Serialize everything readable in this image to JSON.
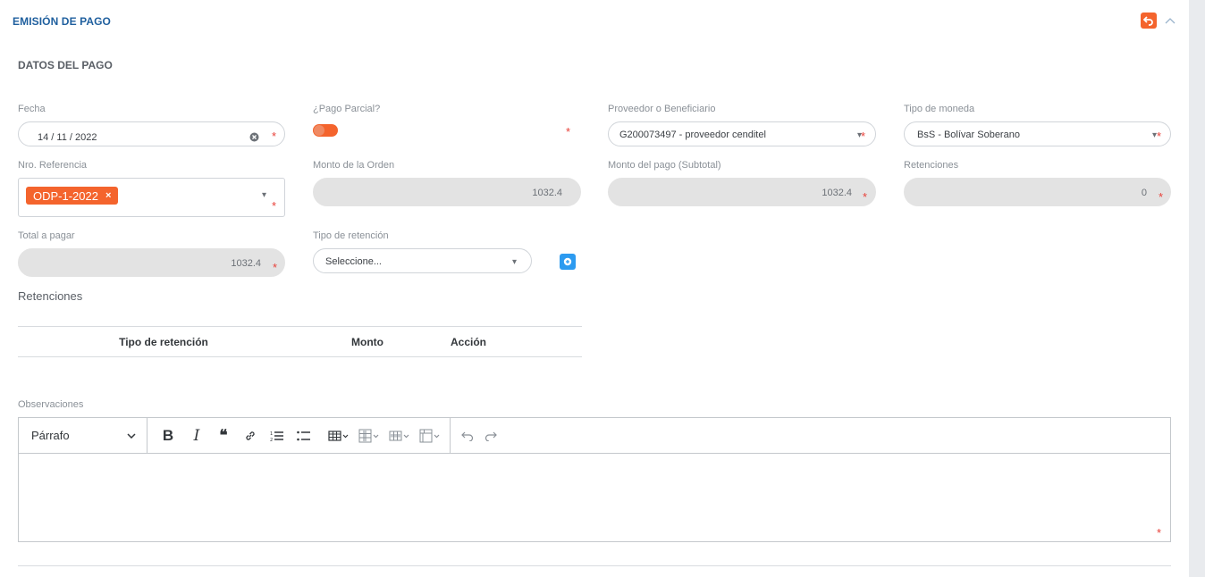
{
  "header": {
    "title": "EMISIÓN DE PAGO",
    "back_icon": "undo-icon",
    "collapse_icon": "chevron-up-icon"
  },
  "section": {
    "title": "DATOS DEL PAGO"
  },
  "fields": {
    "fecha": {
      "label": "Fecha",
      "value": "14 / 11 / 2022"
    },
    "pago_parcial": {
      "label": "¿Pago Parcial?"
    },
    "proveedor": {
      "label": "Proveedor o Beneficiario",
      "value": "G200073497 - proveedor cenditel"
    },
    "moneda": {
      "label": "Tipo de moneda",
      "value": "BsS - Bolívar Soberano"
    },
    "referencia": {
      "label": "Nro. Referencia",
      "tag": "ODP-1-2022",
      "tag_remove": "×"
    },
    "monto_orden": {
      "label": "Monto de la Orden",
      "value": "1032.4"
    },
    "monto_pago": {
      "label": "Monto del pago (Subtotal)",
      "value": "1032.4"
    },
    "retenciones": {
      "label": "Retenciones",
      "value": "0"
    },
    "total": {
      "label": "Total a pagar",
      "value": "1032.4"
    },
    "tipo_retencion": {
      "label": "Tipo de retención",
      "placeholder": "Seleccione..."
    }
  },
  "required_mark": "*",
  "retenciones_table": {
    "title": "Retenciones",
    "columns": [
      "Tipo de retención",
      "Monto",
      "Acción"
    ]
  },
  "observaciones": {
    "label": "Observaciones",
    "paragraph_select": "Párrafo",
    "toolbar_icons": [
      "bold-icon",
      "italic-icon",
      "blockquote-icon",
      "link-icon",
      "numbered-list-icon",
      "bulleted-list-icon",
      "insert-table-icon",
      "table-column-icon",
      "table-row-icon",
      "merge-cells-icon",
      "undo-icon",
      "redo-icon"
    ]
  },
  "colors": {
    "accent": "#f4642d",
    "title_blue": "#1f5f9e",
    "info_blue": "#2d9bf0",
    "required_red": "#e8413a"
  }
}
